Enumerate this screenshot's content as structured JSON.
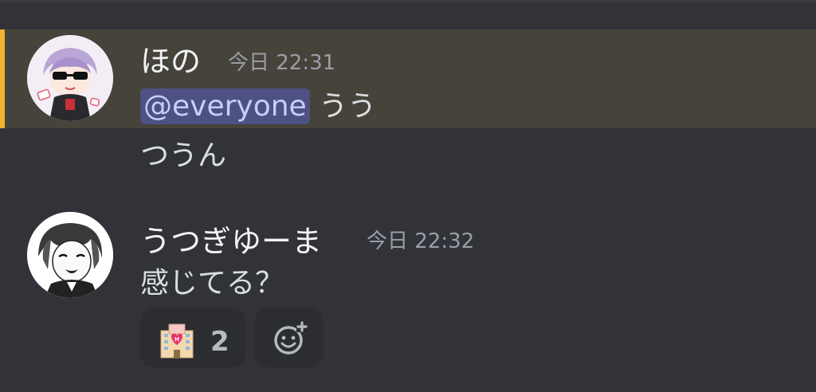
{
  "messages": [
    {
      "username": "ほの",
      "timestamp": "今日 22:31",
      "lines": [
        "@everyone",
        "うう",
        "つうん"
      ],
      "highlighted": true,
      "highlight_color": "#f0b232"
    },
    {
      "username": "うつぎゆーま",
      "timestamp": "今日 22:32",
      "lines": [
        "感じてる？"
      ],
      "reactions": [
        {
          "emoji": "love-hotel-emoji",
          "count": "2"
        }
      ]
    }
  ],
  "add_reaction_icon": "add-reaction-icon",
  "colors": {
    "background": "#313338",
    "highlight_bg": "#46433a",
    "mention_bg": "#4e5183",
    "mention_text": "#c9cdfb"
  }
}
